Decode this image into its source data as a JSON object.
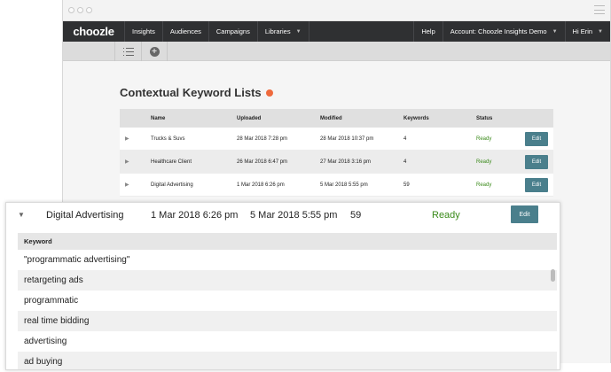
{
  "nav": {
    "logo": "choozle",
    "items": [
      "Insights",
      "Audiences",
      "Campaigns",
      "Libraries"
    ],
    "right": [
      "Help",
      "Account: Choozle Insights Demo",
      "Hi Erin"
    ]
  },
  "page": {
    "title": "Contextual Keyword Lists",
    "badge_color": "#ef6a3d"
  },
  "table": {
    "headers": [
      "Name",
      "Uploaded",
      "Modified",
      "Keywords",
      "Status"
    ],
    "rows": [
      {
        "name": "Trucks & Suvs",
        "uploaded": "28 Mar 2018 7:28 pm",
        "modified": "28 Mar 2018 10:37 pm",
        "keywords": "4",
        "status": "Ready",
        "edit": "Edit"
      },
      {
        "name": "Healthcare Client",
        "uploaded": "26 Mar 2018 6:47 pm",
        "modified": "27 Mar 2018 3:16 pm",
        "keywords": "4",
        "status": "Ready",
        "edit": "Edit"
      },
      {
        "name": "Digital Advertising",
        "uploaded": "1 Mar 2018 6:26 pm",
        "modified": "5 Mar 2018 5:55 pm",
        "keywords": "59",
        "status": "Ready",
        "edit": "Edit"
      }
    ]
  },
  "expanded": {
    "name": "Digital Advertising",
    "uploaded": "1 Mar 2018 6:26 pm",
    "modified": "5 Mar 2018 5:55 pm",
    "keywords": "59",
    "status": "Ready",
    "edit": "Edit",
    "keyword_header": "Keyword",
    "keyword_rows": [
      "\"programmatic advertising\"",
      "retargeting ads",
      "programmatic",
      "real time bidding",
      "advertising",
      "ad buying"
    ]
  },
  "colors": {
    "navbar": "#2f3032",
    "edit_button": "#4a7f8c",
    "ready": "#3a8a1a"
  }
}
